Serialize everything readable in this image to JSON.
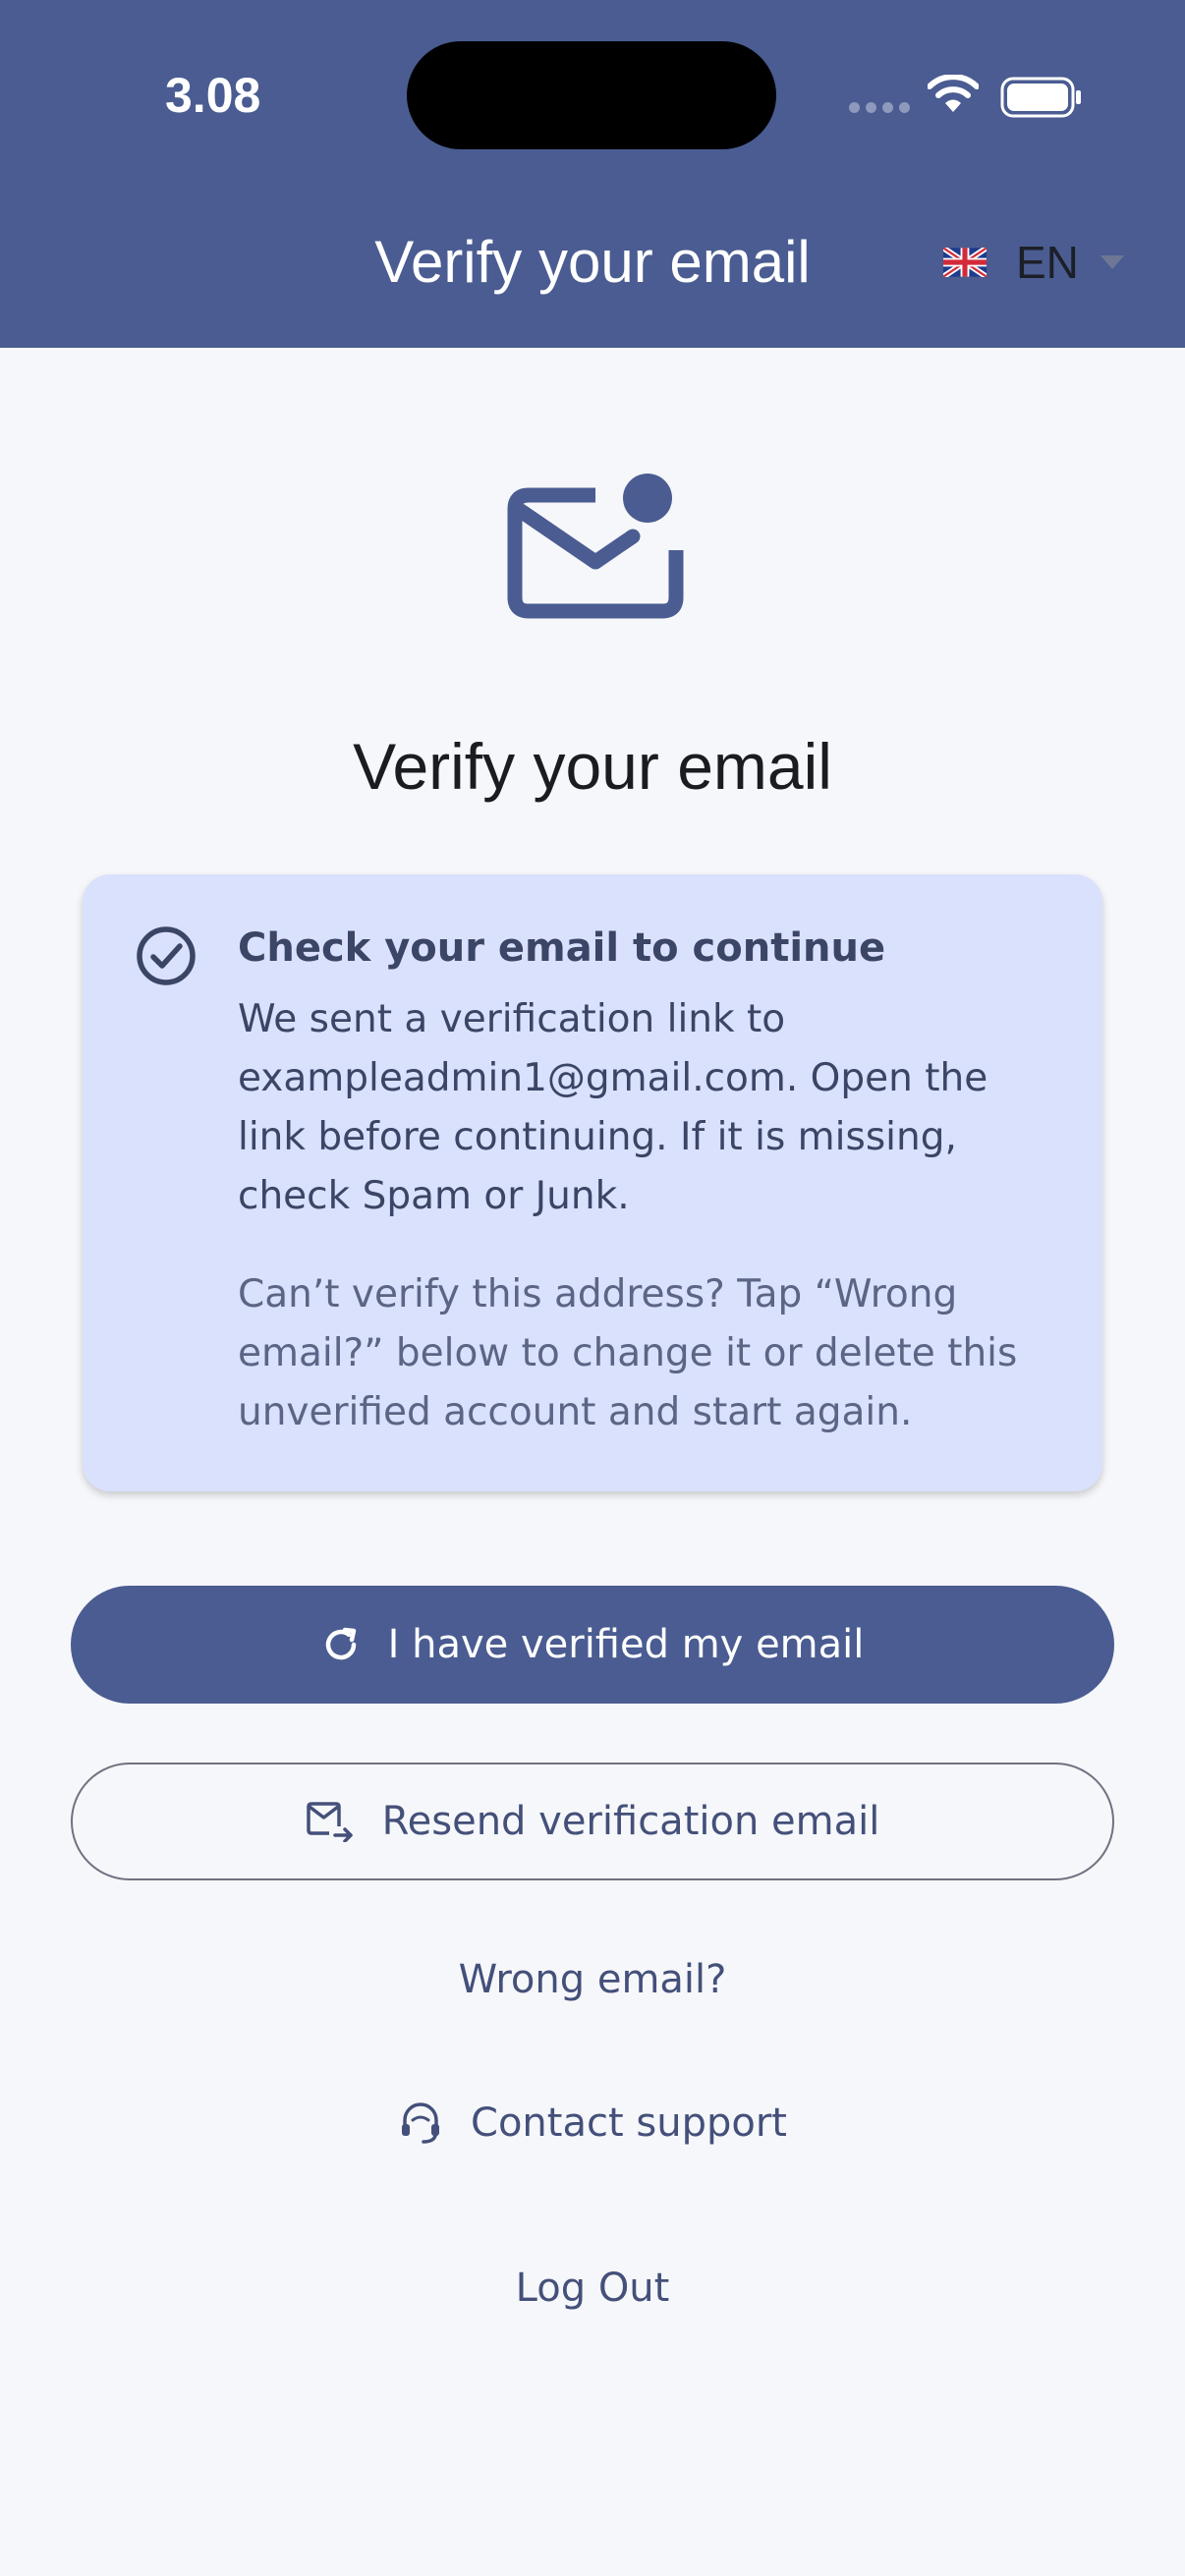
{
  "status_bar": {
    "time": "3.08"
  },
  "appbar": {
    "title": "Verify your email",
    "language": "EN"
  },
  "main": {
    "title": "Verify your email",
    "card": {
      "title": "Check your email to continue",
      "body": "We sent a verification link to exampleadmin1@gmail.com. Open the link before continuing. If it is missing, check Spam or Junk.",
      "note": "Can’t verify this address? Tap “Wrong email?” below to change it or delete this unverified account and start again."
    },
    "buttons": {
      "verified": "I have verified my email",
      "resend": "Resend verification email",
      "wrong_email": "Wrong email?",
      "contact_support": "Contact support",
      "logout": "Log Out"
    }
  },
  "colors": {
    "primary": "#4a5c91",
    "card_bg": "#dae1fd",
    "background": "#f6f7fa"
  },
  "icons": [
    "wifi-icon",
    "battery-icon",
    "uk-flag-icon",
    "mail-notification-icon",
    "check-circle-icon",
    "refresh-icon",
    "mail-forward-icon",
    "headset-icon"
  ]
}
